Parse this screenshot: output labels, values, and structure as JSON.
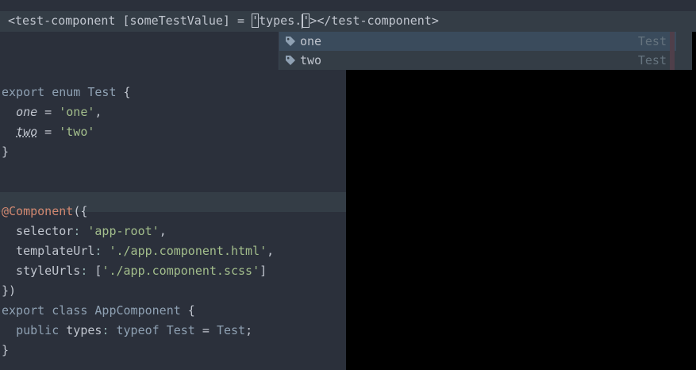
{
  "editor": {
    "top_line": {
      "part1": "<test-component [someTestValue] = ",
      "quote": "'",
      "part2": "types.",
      "part3": "'",
      "part4": "></test-component>"
    },
    "lines": [
      {
        "tokens": [
          {
            "cls": "kw",
            "text": "export"
          },
          {
            "cls": "punct",
            "text": " "
          },
          {
            "cls": "kw",
            "text": "enum"
          },
          {
            "cls": "punct",
            "text": " "
          },
          {
            "cls": "type",
            "text": "Test"
          },
          {
            "cls": "punct",
            "text": " {"
          }
        ]
      },
      {
        "tokens": [
          {
            "cls": "punct",
            "text": "  "
          },
          {
            "cls": "prop",
            "text": "one"
          },
          {
            "cls": "punct",
            "text": " = "
          },
          {
            "cls": "str",
            "text": "'one'"
          },
          {
            "cls": "punct",
            "text": ","
          }
        ]
      },
      {
        "tokens": [
          {
            "cls": "punct",
            "text": "  "
          },
          {
            "cls": "prop squiggle",
            "text": "two"
          },
          {
            "cls": "punct",
            "text": " = "
          },
          {
            "cls": "str",
            "text": "'two'"
          }
        ]
      },
      {
        "tokens": [
          {
            "cls": "punct",
            "text": "}"
          }
        ]
      },
      {
        "tokens": []
      },
      {
        "tokens": []
      },
      {
        "tokens": [
          {
            "cls": "dec",
            "text": "@Component"
          },
          {
            "cls": "punct",
            "text": "({"
          }
        ]
      },
      {
        "tokens": [
          {
            "cls": "punct",
            "text": "  selector"
          },
          {
            "cls": "muted",
            "text": ": "
          },
          {
            "cls": "str",
            "text": "'app-root'"
          },
          {
            "cls": "punct",
            "text": ","
          }
        ]
      },
      {
        "tokens": [
          {
            "cls": "punct",
            "text": "  templateUrl"
          },
          {
            "cls": "muted",
            "text": ": "
          },
          {
            "cls": "str",
            "text": "'./app.component.html'"
          },
          {
            "cls": "punct",
            "text": ","
          }
        ]
      },
      {
        "tokens": [
          {
            "cls": "punct",
            "text": "  styleUrls"
          },
          {
            "cls": "muted",
            "text": ": "
          },
          {
            "cls": "punct",
            "text": "["
          },
          {
            "cls": "str",
            "text": "'./app.component.scss'"
          },
          {
            "cls": "punct",
            "text": "]"
          }
        ]
      },
      {
        "tokens": [
          {
            "cls": "punct",
            "text": "})"
          }
        ]
      },
      {
        "tokens": [
          {
            "cls": "kw",
            "text": "export"
          },
          {
            "cls": "punct",
            "text": " "
          },
          {
            "cls": "kw",
            "text": "class"
          },
          {
            "cls": "punct",
            "text": " "
          },
          {
            "cls": "type",
            "text": "AppComponent"
          },
          {
            "cls": "punct",
            "text": " {"
          }
        ]
      },
      {
        "tokens": [
          {
            "cls": "punct",
            "text": "  "
          },
          {
            "cls": "kw",
            "text": "public"
          },
          {
            "cls": "punct",
            "text": " types"
          },
          {
            "cls": "muted",
            "text": ": "
          },
          {
            "cls": "kw",
            "text": "typeof"
          },
          {
            "cls": "punct",
            "text": " "
          },
          {
            "cls": "type",
            "text": "Test"
          },
          {
            "cls": "punct",
            "text": " = "
          },
          {
            "cls": "type",
            "text": "Test"
          },
          {
            "cls": "punct",
            "text": ";"
          }
        ]
      },
      {
        "tokens": [
          {
            "cls": "punct",
            "text": "}"
          }
        ]
      }
    ]
  },
  "autocomplete": {
    "items": [
      {
        "label": "one",
        "type": "Test",
        "icon": "tag-icon"
      },
      {
        "label": "two",
        "type": "Test",
        "icon": "tag-icon"
      }
    ],
    "icon_color": "#8fa1b3"
  }
}
